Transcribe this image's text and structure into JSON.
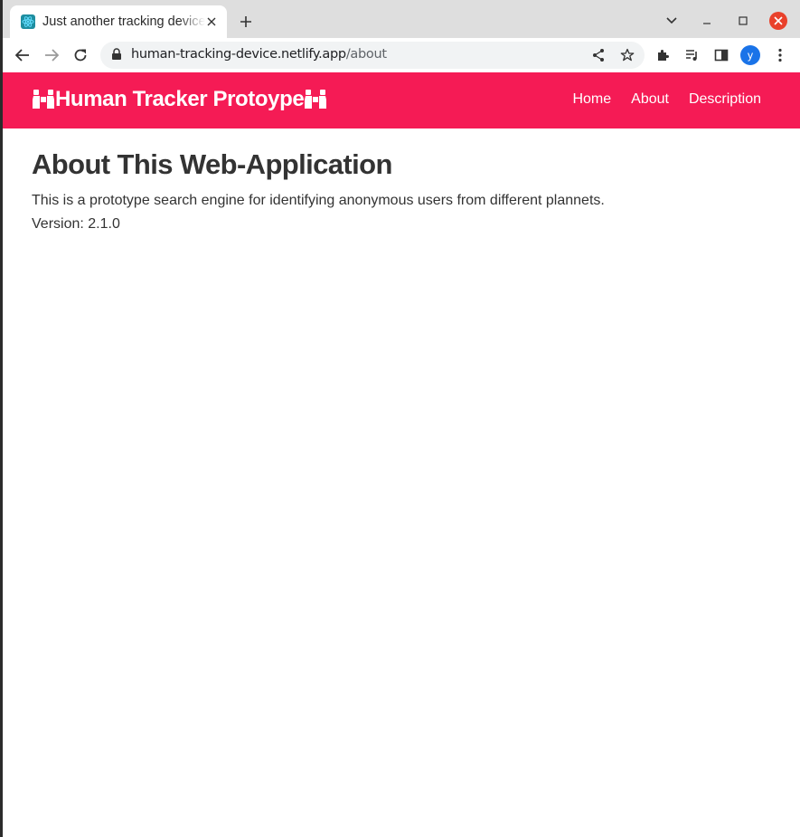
{
  "browser": {
    "tab": {
      "title": "Just another tracking device",
      "favicon": "react-atom-icon"
    },
    "url": {
      "domain": "human-tracking-device.netlify.app",
      "path": "/about"
    },
    "profile_initial": "y",
    "colors": {
      "chrome_bg": "#dedede",
      "close_button": "#e9412b",
      "profile": "#1a73e8"
    }
  },
  "navbar": {
    "brand_text": "Human Tracker Protoype",
    "brand_icon": "binoculars-icon",
    "links": [
      "Home",
      "About",
      "Description"
    ],
    "color": "#f51b55"
  },
  "content": {
    "heading": "About This Web-Application",
    "description": "This is a prototype search engine for identifying anonymous users from different plannets.",
    "version": "Version: 2.1.0"
  }
}
